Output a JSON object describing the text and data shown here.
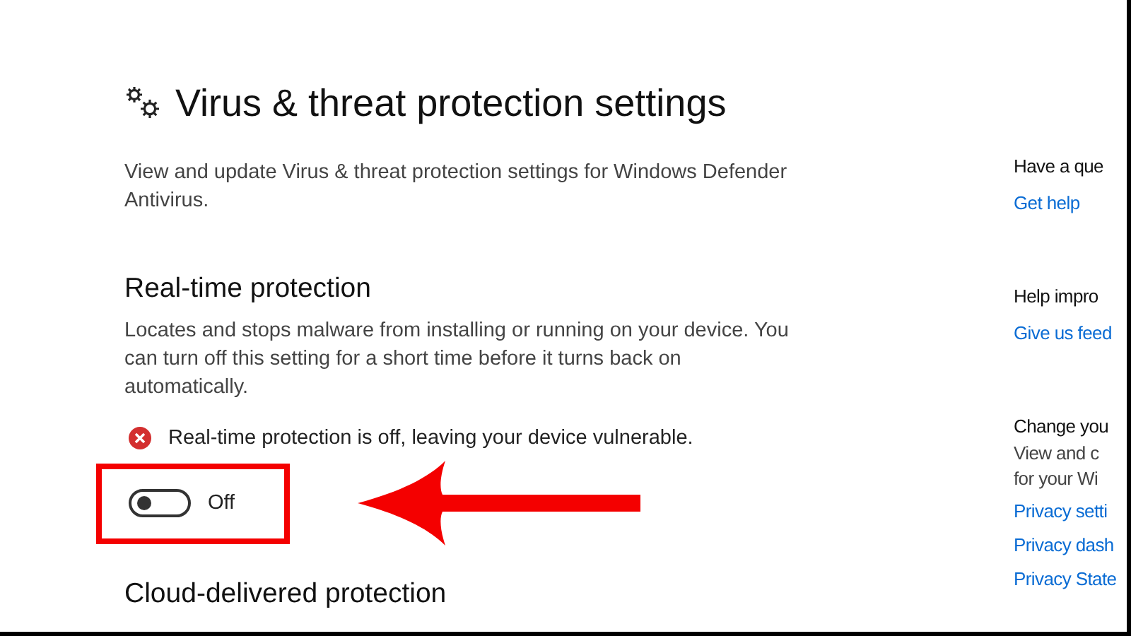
{
  "page": {
    "title": "Virus & threat protection settings",
    "description": "View and update Virus & threat protection settings for Windows Defender Antivirus."
  },
  "realtime": {
    "heading": "Real-time protection",
    "description": "Locates and stops malware from installing or running on your device. You can turn off this setting for a short time before it turns back on automatically.",
    "warning": "Real-time protection is off, leaving your device vulnerable.",
    "toggle": {
      "on": false,
      "label": "Off"
    },
    "highlighted": true
  },
  "next_section": {
    "heading": "Cloud-delivered protection"
  },
  "sidebar": [
    {
      "heading": "Have a que",
      "links": [
        "Get help"
      ]
    },
    {
      "heading": "Help impro",
      "links": [
        "Give us feed"
      ]
    },
    {
      "heading": "Change you",
      "text": [
        "View and c",
        "for your Wi"
      ],
      "links": [
        "Privacy setti",
        "Privacy dash",
        "Privacy State"
      ]
    }
  ]
}
